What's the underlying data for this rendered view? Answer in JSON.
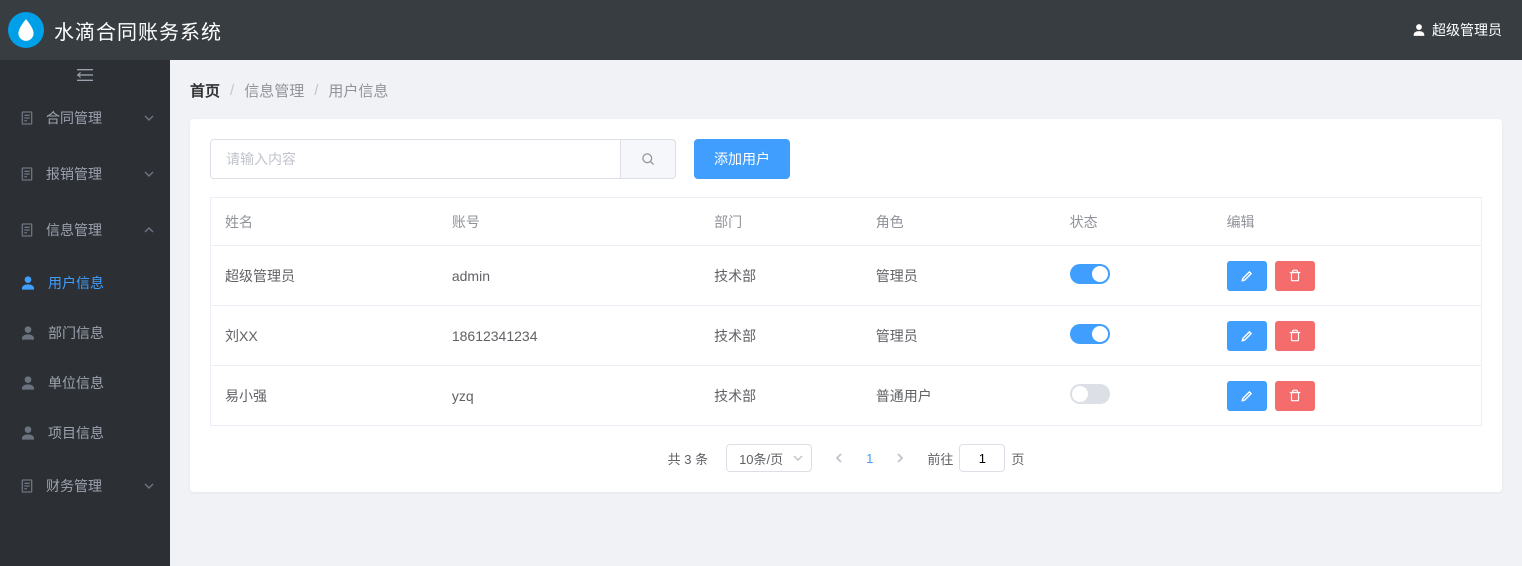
{
  "header": {
    "title": "水滴合同账务系统",
    "user": "超级管理员"
  },
  "sidebar": {
    "items": [
      {
        "label": "合同管理",
        "expanded": false
      },
      {
        "label": "报销管理",
        "expanded": false
      },
      {
        "label": "信息管理",
        "expanded": true,
        "children": [
          {
            "label": "用户信息",
            "active": true
          },
          {
            "label": "部门信息",
            "active": false
          },
          {
            "label": "单位信息",
            "active": false
          },
          {
            "label": "项目信息",
            "active": false
          }
        ]
      },
      {
        "label": "财务管理",
        "expanded": false
      }
    ]
  },
  "breadcrumb": {
    "home": "首页",
    "crumb1": "信息管理",
    "crumb2": "用户信息"
  },
  "toolbar": {
    "search_placeholder": "请输入内容",
    "add_label": "添加用户"
  },
  "table": {
    "headers": {
      "name": "姓名",
      "account": "账号",
      "dept": "部门",
      "role": "角色",
      "status": "状态",
      "edit": "编辑"
    },
    "rows": [
      {
        "name": "超级管理员",
        "account": "admin",
        "dept": "技术部",
        "role": "管理员",
        "status": true
      },
      {
        "name": "刘XX",
        "account": "18612341234",
        "dept": "技术部",
        "role": "管理员",
        "status": true
      },
      {
        "name": "易小强",
        "account": "yzq",
        "dept": "技术部",
        "role": "普通用户",
        "status": false
      }
    ]
  },
  "pagination": {
    "total_prefix": "共",
    "total_suffix": "条",
    "total": "3",
    "page_size": "10条/页",
    "current": "1",
    "goto_prefix": "前往",
    "goto_suffix": "页",
    "goto_value": "1"
  }
}
